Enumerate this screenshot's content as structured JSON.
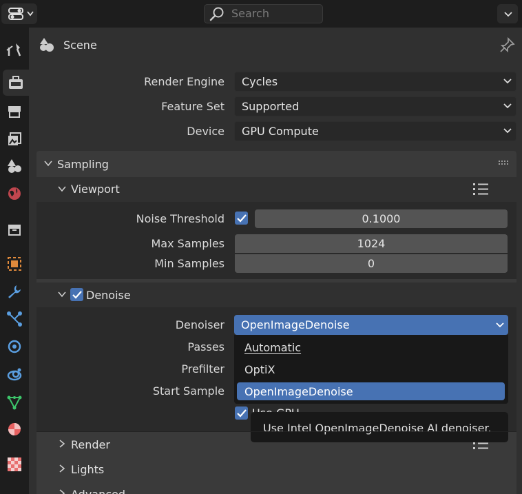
{
  "search": {
    "placeholder": "Search"
  },
  "header": {
    "title": "Scene"
  },
  "render": {
    "engine_label": "Render Engine",
    "engine_value": "Cycles",
    "feature_label": "Feature Set",
    "feature_value": "Supported",
    "device_label": "Device",
    "device_value": "GPU Compute"
  },
  "sampling": {
    "title": "Sampling",
    "viewport": {
      "title": "Viewport",
      "noise_label": "Noise Threshold",
      "noise_value": "0.1000",
      "max_label": "Max Samples",
      "max_value": "1024",
      "min_label": "Min Samples",
      "min_value": "0"
    },
    "denoise": {
      "title": "Denoise",
      "denoiser_label": "Denoiser",
      "denoiser_value": "OpenImageDenoise",
      "passes_label": "Passes",
      "prefilter_label": "Prefilter",
      "start_label": "Start Sample",
      "gpu_label": "Use GPU"
    },
    "collapsed": [
      "Render",
      "Lights",
      "Advanced"
    ]
  },
  "dropdown": {
    "options": [
      "Automatic",
      "OptiX",
      "OpenImageDenoise"
    ],
    "selected": "OpenImageDenoise"
  },
  "tooltip": {
    "text": "Use Intel OpenImageDenoise AI denoiser."
  },
  "colors": {
    "accent": "#4772b3",
    "panel": "#303030"
  }
}
